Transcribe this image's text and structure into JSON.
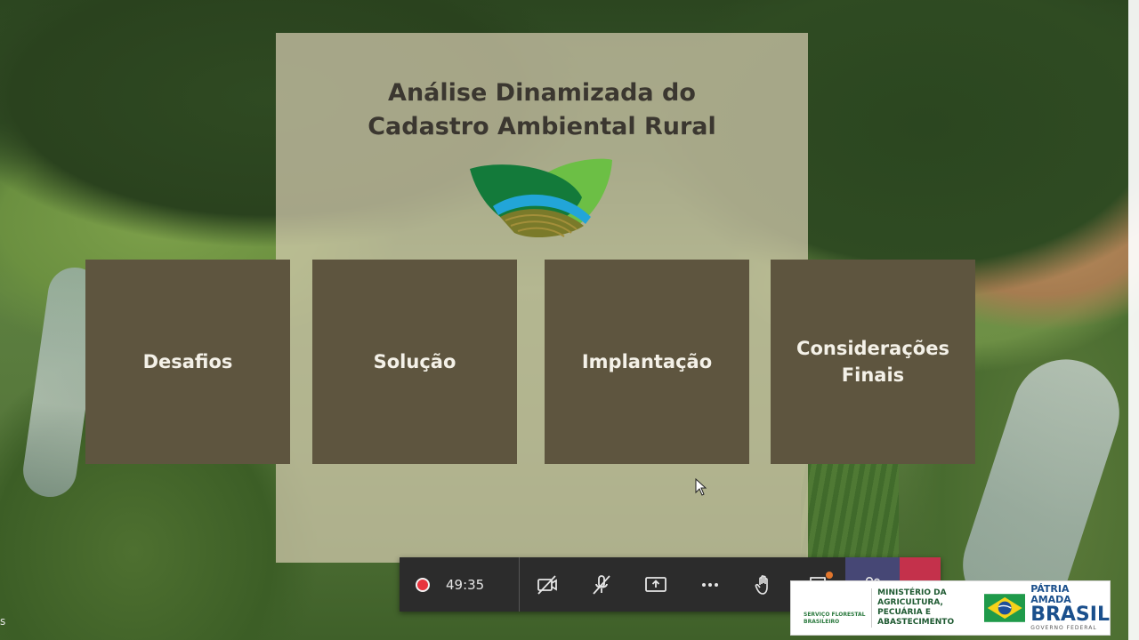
{
  "slide": {
    "title_line1": "Análise Dinamizada do",
    "title_line2": "Cadastro Ambiental Rural",
    "logo_icon": "leaf-landscape-logo",
    "tiles": [
      {
        "label": "Desafios"
      },
      {
        "label": "Solução"
      },
      {
        "label": "Implantação"
      },
      {
        "label": "Considerações\nFinais"
      }
    ]
  },
  "call_controls": {
    "timer": "49:35",
    "icons": [
      "record-icon",
      "camera-off-icon",
      "mic-off-icon",
      "share-screen-icon",
      "more-icon",
      "raise-hand-icon",
      "chat-icon",
      "participants-icon",
      "hang-up-icon"
    ],
    "colors": {
      "bar": "#2c2c2c",
      "participants": "#464775",
      "hangup": "#c4314b",
      "record": "#e8343e"
    }
  },
  "banner": {
    "left_text": "SERVIÇO FLORESTAL BRASILEIRO",
    "ministry": "MINISTÉRIO DA AGRICULTURA, PECUÁRIA E ABASTECIMENTO",
    "brand_line1": "PÁTRIA AMADA",
    "brand_line2": "BRASIL",
    "brand_line3": "GOVERNO FEDERAL"
  },
  "corner_text": "s"
}
